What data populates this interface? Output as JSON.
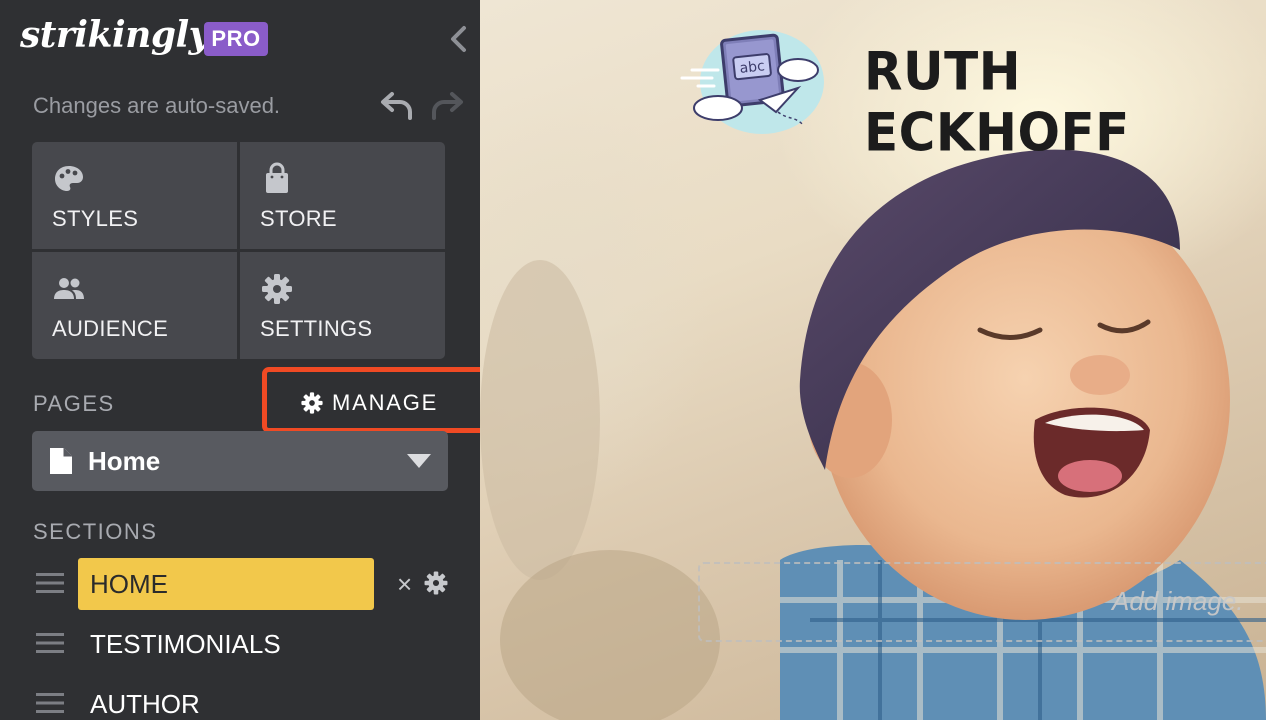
{
  "app": {
    "brand": "strikingly",
    "plan_badge": "PRO",
    "autosave_status": "Changes are auto-saved."
  },
  "menu_tiles": [
    {
      "label": "STYLES",
      "icon": "palette-icon"
    },
    {
      "label": "STORE",
      "icon": "shopping-bag-icon"
    },
    {
      "label": "AUDIENCE",
      "icon": "people-icon"
    },
    {
      "label": "SETTINGS",
      "icon": "gear-icon"
    }
  ],
  "pages": {
    "heading": "PAGES",
    "manage_label": "MANAGE",
    "current_page": "Home"
  },
  "sections": {
    "heading": "SECTIONS",
    "items": [
      {
        "label": "HOME",
        "active": true
      },
      {
        "label": "TESTIMONIALS",
        "active": false
      },
      {
        "label": "AUTHOR",
        "active": false
      }
    ],
    "delete_symbol": "×"
  },
  "site": {
    "title": "RUTH ECKHOFF",
    "logo_text": "abc",
    "add_image_label": "Add image."
  },
  "colors": {
    "sidebar_bg": "#2f3033",
    "tile_bg": "#47484d",
    "pro_badge": "#8a5cc9",
    "active_section": "#f2c84b",
    "highlight_outline": "#f04a24"
  }
}
